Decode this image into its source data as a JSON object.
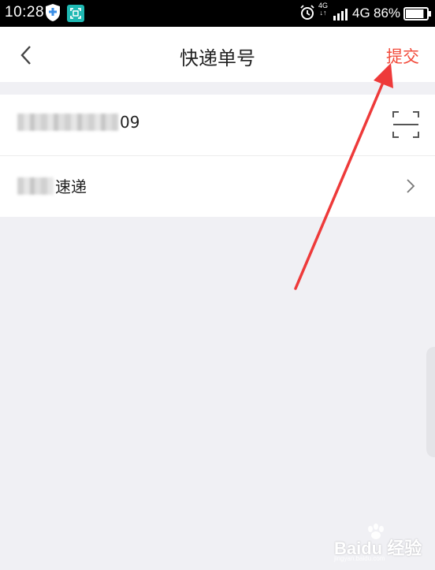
{
  "status_bar": {
    "time": "10:28",
    "net_small_top": "4G",
    "net_small_bottom": "↓↑",
    "network_type": "4G",
    "battery_percent": "86%",
    "battery_level": 86
  },
  "nav": {
    "title": "快递单号",
    "submit_label": "提交"
  },
  "form": {
    "tracking_number_visible": "09",
    "courier_visible": "速递"
  },
  "watermark": {
    "brand": "Baidu 经验",
    "sub": "jingyan.baidu.com"
  },
  "colors": {
    "accent": "#f24a3a",
    "background": "#f0f0f4"
  }
}
